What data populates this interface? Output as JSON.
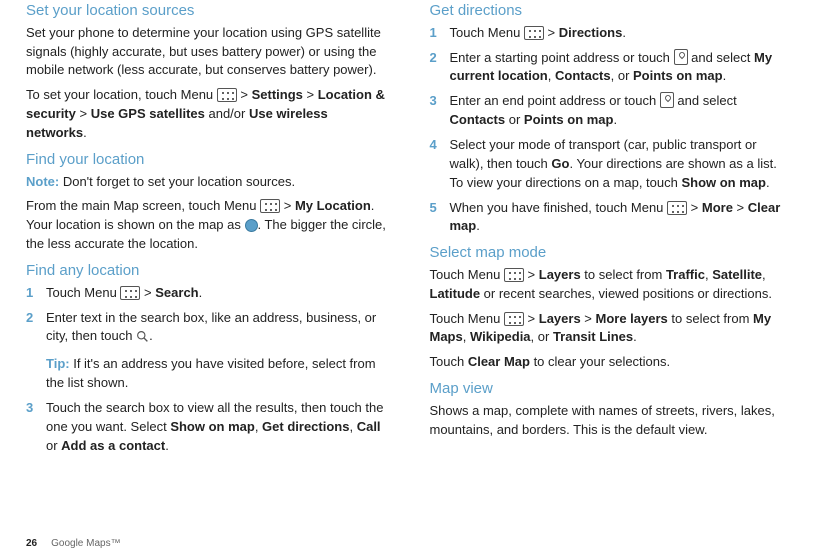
{
  "left": {
    "section1": {
      "heading": "Set your location sources",
      "p1": "Set your phone to determine your location using GPS satellite signals (highly accurate, but uses battery power) or using the mobile network (less accurate, but conserves battery power).",
      "p2a": "To set your location, touch Menu ",
      "p2b": " > ",
      "settings": "Settings",
      "p2c": " > ",
      "locsec": "Location & security",
      "p2d": " > ",
      "gps": "Use GPS satellites",
      "p2e": " and/or ",
      "wireless": "Use wireless networks",
      "p2f": "."
    },
    "section2": {
      "heading": "Find your location",
      "noteLabel": "Note:",
      "noteText": " Don't forget to set your location sources.",
      "p1a": "From the main Map screen, touch Menu ",
      "p1b": " > ",
      "myloc": "My Location",
      "p1c": ". Your location is shown on the map as ",
      "p1d": ". The bigger the circle, the less accurate the location."
    },
    "section3": {
      "heading": "Find any location",
      "step1": {
        "n": "1",
        "a": "Touch Menu ",
        "b": " > ",
        "search": "Search",
        "c": "."
      },
      "step2": {
        "n": "2",
        "p1a": "Enter text in the search box, like an address, business, or city, then touch ",
        "p1b": ".",
        "tipLabel": "Tip:",
        "tipText": " If it's an address you have visited before, select from the list shown."
      },
      "step3": {
        "n": "3",
        "a": "Touch the search box to view all the results, then touch the one you want. Select ",
        "show": "Show on map",
        "b": ", ",
        "getdir": "Get directions",
        "c": ", ",
        "call": "Call",
        "d": " or ",
        "add": "Add as a contact",
        "e": "."
      }
    }
  },
  "right": {
    "section1": {
      "heading": "Get directions",
      "step1": {
        "n": "1",
        "a": "Touch Menu ",
        "b": " > ",
        "dir": "Directions",
        "c": "."
      },
      "step2": {
        "n": "2",
        "a": "Enter a starting point address or touch ",
        "b": " and select ",
        "mycur": "My current location",
        "c": ", ",
        "contacts": "Contacts",
        "d": ", or ",
        "points": "Points on map",
        "e": "."
      },
      "step3": {
        "n": "3",
        "a": "Enter an end point address or touch ",
        "b": " and select ",
        "contacts": "Contacts",
        "c": " or ",
        "points": "Points on map",
        "d": "."
      },
      "step4": {
        "n": "4",
        "a": "Select your mode of transport (car, public transport or walk), then touch ",
        "go": "Go",
        "b": ". Your directions are shown as a list. To view your directions on a map, touch ",
        "show": "Show on map",
        "c": "."
      },
      "step5": {
        "n": "5",
        "a": "When you have finished, touch Menu ",
        "b": " > ",
        "more": "More",
        "c": " > ",
        "clear": "Clear map",
        "d": "."
      }
    },
    "section2": {
      "heading": "Select map mode",
      "p1a": "Touch Menu ",
      "p1b": " > ",
      "layers": "Layers",
      "p1c": " to select from ",
      "traffic": "Traffic",
      "p1d": ", ",
      "sat": "Satellite",
      "p1e": ", ",
      "lat": "Latitude",
      "p1f": " or recent searches, viewed positions or directions.",
      "p2a": "Touch Menu ",
      "p2b": " > ",
      "layers2": "Layers",
      "p2c": " > ",
      "more": "More layers",
      "p2d": " to select from ",
      "mymaps": "My Maps",
      "p2e": ", ",
      "wiki": "Wikipedia",
      "p2f": ", or ",
      "transit": "Transit Lines",
      "p2g": ".",
      "p3a": "Touch ",
      "clearmap": "Clear Map",
      "p3b": " to clear your selections."
    },
    "section3": {
      "heading": "Map view",
      "p1": "Shows a map, complete with names of streets, rivers, lakes, mountains, and borders. This is the default view."
    }
  },
  "footer": {
    "page": "26",
    "title": "Google Maps™"
  }
}
